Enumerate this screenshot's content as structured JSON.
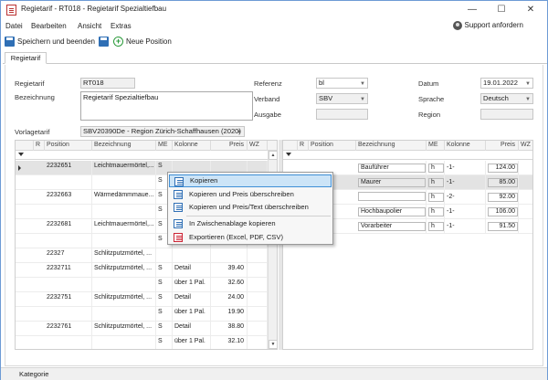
{
  "window": {
    "title": "Regietarif - RT018 - Regietarif Spezialtiefbau",
    "minimize": "—",
    "maximize": "☐",
    "close": "✕"
  },
  "menu": {
    "items": [
      "Datei",
      "Bearbeiten",
      "Ansicht",
      "Extras"
    ],
    "support": "Support anfordern"
  },
  "toolbar": {
    "save_close": "Speichern und beenden",
    "new_position": "Neue Position"
  },
  "tabs": [
    "Regietarif"
  ],
  "form": {
    "regietarif_label": "Regietarif",
    "regietarif_value": "RT018",
    "bezeichnung_label": "Bezeichnung",
    "bezeichnung_value": "Regietarif Spezialtiefbau",
    "referenz_label": "Referenz",
    "referenz_value": "bl",
    "verband_label": "Verband",
    "verband_value": "SBV",
    "ausgabe_label": "Ausgabe",
    "ausgabe_value": "",
    "datum_label": "Datum",
    "datum_value": "19.01.2022",
    "sprache_label": "Sprache",
    "sprache_value": "Deutsch",
    "region_label": "Region",
    "region_value": "",
    "vorlagetarif_label": "Vorlagetarif",
    "vorlagetarif_value": "SBV20390De - Region Zürich-Schaffhausen (2020)"
  },
  "left_grid": {
    "headers": [
      "R",
      "Position",
      "Bezeichnung",
      "ME",
      "Kolonne",
      "Preis",
      "WZ"
    ],
    "rows": [
      {
        "pos": "2232651",
        "bez": "Leichtmauermörtel,...",
        "me": "S",
        "kol": "",
        "preis": "",
        "sel": true
      },
      {
        "pos": "",
        "bez": "",
        "me": "S",
        "kol": "",
        "preis": "",
        "sel": false
      },
      {
        "pos": "2232663",
        "bez": "Wärmedämmmaue...",
        "me": "S",
        "kol": "",
        "preis": "",
        "sel": false
      },
      {
        "pos": "",
        "bez": "",
        "me": "S",
        "kol": "",
        "preis": "",
        "sel": false
      },
      {
        "pos": "2232681",
        "bez": "Leichtmauermörtel,...",
        "me": "S",
        "kol": "",
        "preis": "",
        "sel": false
      },
      {
        "pos": "",
        "bez": "",
        "me": "S",
        "kol": "",
        "preis": "",
        "sel": false
      },
      {
        "pos": "22327",
        "bez": "Schlitzputzmörtel, ...",
        "me": "",
        "kol": "",
        "preis": "",
        "sel": false
      },
      {
        "pos": "2232711",
        "bez": "Schlitzputzmörtel, ...",
        "me": "S",
        "kol": "Detail",
        "preis": "39.40",
        "sel": false
      },
      {
        "pos": "",
        "bez": "",
        "me": "S",
        "kol": "über 1 Pal.",
        "preis": "32.60",
        "sel": false
      },
      {
        "pos": "2232751",
        "bez": "Schlitzputzmörtel, ...",
        "me": "S",
        "kol": "Detail",
        "preis": "24.00",
        "sel": false
      },
      {
        "pos": "",
        "bez": "",
        "me": "S",
        "kol": "über 1 Pal.",
        "preis": "19.90",
        "sel": false
      },
      {
        "pos": "2232761",
        "bez": "Schlitzputzmörtel, ...",
        "me": "S",
        "kol": "Detail",
        "preis": "38.80",
        "sel": false
      },
      {
        "pos": "",
        "bez": "",
        "me": "S",
        "kol": "über 1 Pal.",
        "preis": "32.10",
        "sel": false
      }
    ]
  },
  "right_grid": {
    "headers": [
      "R",
      "Position",
      "Bezeichnung",
      "ME",
      "Kolonne",
      "Preis",
      "WZ"
    ],
    "rows": [
      {
        "bez": "Bauführer",
        "me": "h",
        "kol": "-1-",
        "preis": "124.00",
        "sel": false
      },
      {
        "bez": "Maurer",
        "me": "h",
        "kol": "-1-",
        "preis": "85.00",
        "sel": true
      },
      {
        "bez": "",
        "me": "h",
        "kol": "-2-",
        "preis": "92.00",
        "sel": false
      },
      {
        "bez": "Hochbaupolier",
        "me": "h",
        "kol": "-1-",
        "preis": "106.00",
        "sel": false
      },
      {
        "bez": "Vorarbeiter",
        "me": "h",
        "kol": "-1-",
        "preis": "91.50",
        "sel": false
      }
    ]
  },
  "context_menu": {
    "items": [
      "Kopieren",
      "Kopieren und Preis überschreiben",
      "Kopieren und Preis/Text überschreiben",
      "In Zwischenablage kopieren",
      "Exportieren (Excel, PDF, CSV)"
    ]
  },
  "statusbar": {
    "kategorie": "Kategorie"
  }
}
